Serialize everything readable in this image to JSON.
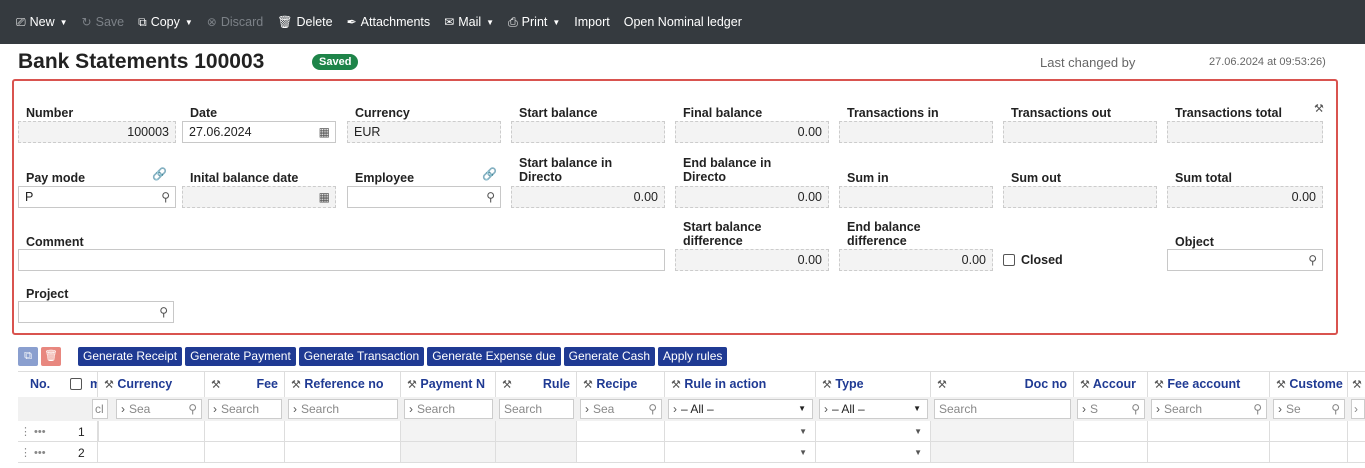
{
  "toolbar": {
    "new": "New",
    "save": "Save",
    "copy": "Copy",
    "discard": "Discard",
    "delete": "Delete",
    "attachments": "Attachments",
    "mail": "Mail",
    "print": "Print",
    "import": "Import",
    "open_nominal": "Open Nominal ledger"
  },
  "header": {
    "title": "Bank Statements 100003",
    "badge": "Saved",
    "last_changed_label": "Last changed by",
    "last_changed_date": "27.06.2024 at 09:53:26)"
  },
  "form": {
    "number": {
      "label": "Number",
      "value": "100003"
    },
    "date": {
      "label": "Date",
      "value": "27.06.2024"
    },
    "currency": {
      "label": "Currency",
      "value": "EUR"
    },
    "start_balance": {
      "label": "Start balance",
      "value": ""
    },
    "final_balance": {
      "label": "Final balance",
      "value": "0.00"
    },
    "transactions_in": {
      "label": "Transactions in",
      "value": ""
    },
    "transactions_out": {
      "label": "Transactions out",
      "value": ""
    },
    "transactions_total": {
      "label": "Transactions total",
      "value": ""
    },
    "pay_mode": {
      "label": "Pay mode",
      "value": "P"
    },
    "initial_balance_date": {
      "label": "Inital balance date",
      "value": ""
    },
    "employee": {
      "label": "Employee",
      "value": ""
    },
    "start_balance_directo": {
      "label1": "Start balance in",
      "label2": "Directo",
      "value": "0.00"
    },
    "end_balance_directo": {
      "label1": "End balance in",
      "label2": "Directo",
      "value": "0.00"
    },
    "sum_in": {
      "label": "Sum in",
      "value": ""
    },
    "sum_out": {
      "label": "Sum out",
      "value": ""
    },
    "sum_total": {
      "label": "Sum total",
      "value": "0.00"
    },
    "comment": {
      "label": "Comment",
      "value": ""
    },
    "start_balance_diff": {
      "label1": "Start balance",
      "label2": "difference",
      "value": "0.00"
    },
    "end_balance_diff": {
      "label1": "End balance",
      "label2": "difference",
      "value": "0.00"
    },
    "closed": {
      "label": "Closed"
    },
    "object": {
      "label": "Object",
      "value": ""
    },
    "project": {
      "label": "Project",
      "value": ""
    }
  },
  "actions": [
    "Generate Receipt",
    "Generate Payment",
    "Generate Transaction",
    "Generate Expense due",
    "Generate Cash",
    "Apply rules"
  ],
  "grid": {
    "headers": {
      "no": "No.",
      "m": "m",
      "currency": "Currency",
      "fee": "Fee",
      "reference": "Reference no",
      "payment": "Payment N",
      "rule": "Rule",
      "recipe": "Recipe",
      "rule_action": "Rule in action",
      "type": "Type",
      "doc_no": "Doc no",
      "account": "Accour",
      "fee_account": "Fee account",
      "customer": "Custome"
    },
    "filters": {
      "m": "cl",
      "currency": "Sea",
      "fee": "Search",
      "reference": "Search",
      "payment": "Search",
      "rule": "Search",
      "recipe": "Sea",
      "rule_action": "– All –",
      "type": "– All –",
      "doc_no": "Search",
      "account": "S",
      "fee_account": "Search",
      "customer": "Se"
    },
    "rows": [
      "1",
      "2"
    ]
  }
}
